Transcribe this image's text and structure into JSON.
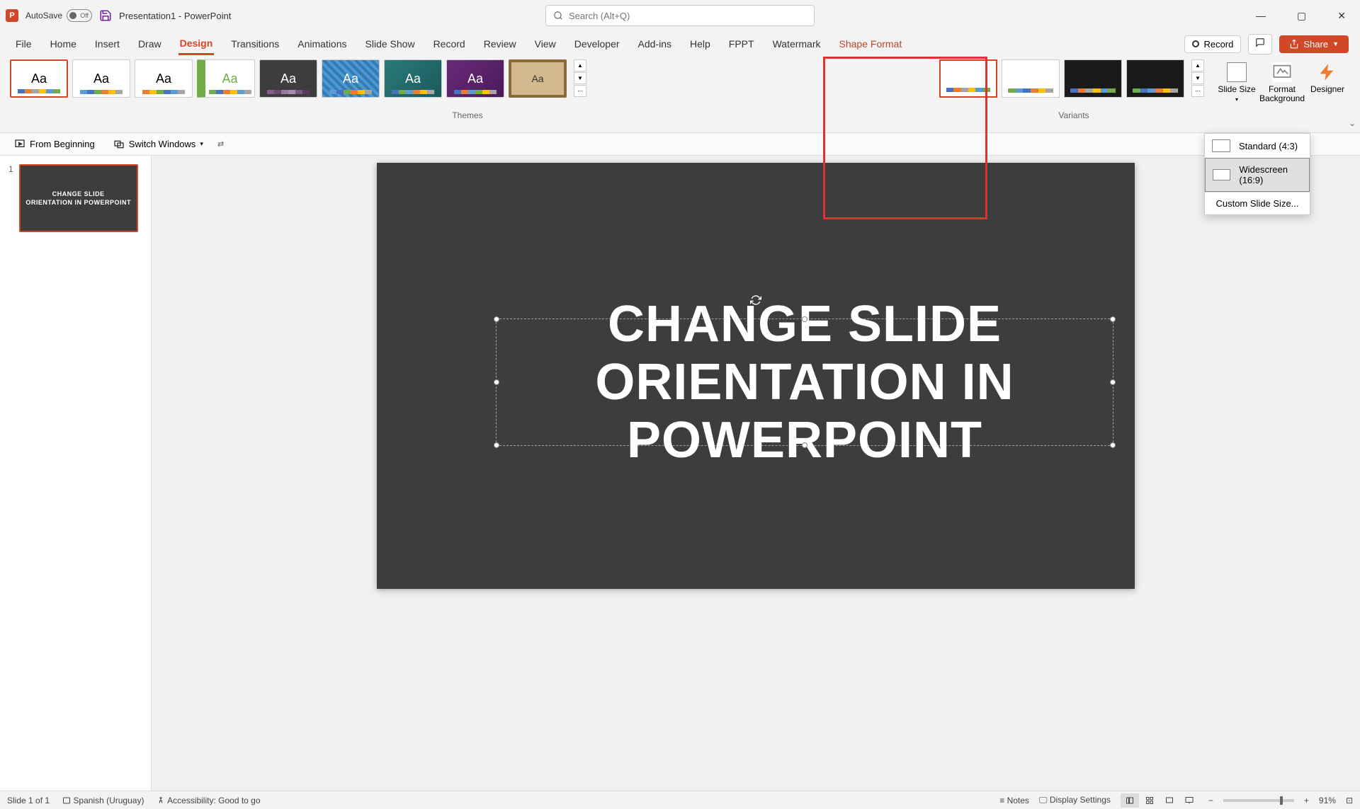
{
  "titlebar": {
    "autosave_label": "AutoSave",
    "autosave_state": "Off",
    "doc_title": "Presentation1 - PowerPoint",
    "search_placeholder": "Search (Alt+Q)"
  },
  "tabs": {
    "file": "File",
    "home": "Home",
    "insert": "Insert",
    "draw": "Draw",
    "design": "Design",
    "transitions": "Transitions",
    "animations": "Animations",
    "slideshow": "Slide Show",
    "record": "Record",
    "review": "Review",
    "view": "View",
    "developer": "Developer",
    "addins": "Add-ins",
    "help": "Help",
    "fppt": "FPPT",
    "watermark": "Watermark",
    "shapeformat": "Shape Format"
  },
  "top_right": {
    "record": "Record",
    "share": "Share"
  },
  "ribbon": {
    "themes_label": "Themes",
    "variants_label": "Variants",
    "slide_size": "Slide Size",
    "format_bg": "Format Background",
    "designer": "Designer"
  },
  "dropdown": {
    "standard": "Standard (4:3)",
    "widescreen": "Widescreen (16:9)",
    "custom": "Custom Slide Size..."
  },
  "qat": {
    "from_beginning": "From Beginning",
    "switch_windows": "Switch Windows"
  },
  "slide": {
    "number": "1",
    "title_line1": "CHANGE SLIDE",
    "title_line2": "ORIENTATION IN POWERPOINT"
  },
  "thumb": {
    "line1": "CHANGE SLIDE",
    "line2": "ORIENTATION IN POWERPOINT"
  },
  "status": {
    "slide_info": "Slide 1 of 1",
    "language": "Spanish (Uruguay)",
    "accessibility": "Accessibility: Good to go",
    "notes": "Notes",
    "display": "Display Settings",
    "zoom": "91%"
  }
}
